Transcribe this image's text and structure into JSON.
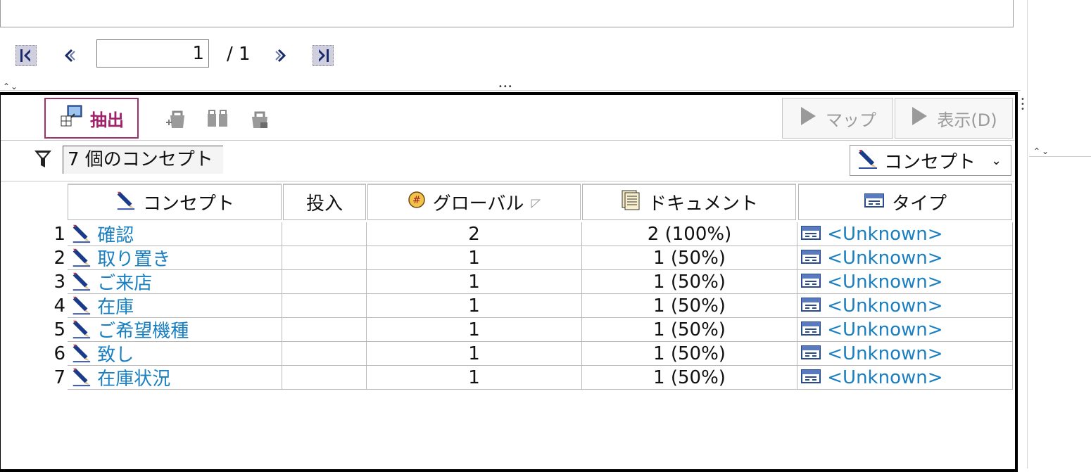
{
  "pager": {
    "current_page": "1",
    "total": "/ 1"
  },
  "toolbar": {
    "extract_label": "抽出",
    "map_label": "マップ",
    "show_label": "表示(D)"
  },
  "filter": {
    "summary": "7 個のコンセプト",
    "view_select": "コンセプト"
  },
  "table": {
    "headers": {
      "concept": "コンセプト",
      "input": "投入",
      "global": "グローバル",
      "document": "ドキュメント",
      "type": "タイプ"
    },
    "rows": [
      {
        "index": "1",
        "concept": "確認",
        "input": "",
        "global": "2",
        "document": "2 (100%)",
        "type": "<Unknown>"
      },
      {
        "index": "2",
        "concept": "取り置き",
        "input": "",
        "global": "1",
        "document": "1 (50%)",
        "type": "<Unknown>"
      },
      {
        "index": "3",
        "concept": "ご来店",
        "input": "",
        "global": "1",
        "document": "1 (50%)",
        "type": "<Unknown>"
      },
      {
        "index": "4",
        "concept": "在庫",
        "input": "",
        "global": "1",
        "document": "1 (50%)",
        "type": "<Unknown>"
      },
      {
        "index": "5",
        "concept": "ご希望機種",
        "input": "",
        "global": "1",
        "document": "1 (50%)",
        "type": "<Unknown>"
      },
      {
        "index": "6",
        "concept": "致し",
        "input": "",
        "global": "1",
        "document": "1 (50%)",
        "type": "<Unknown>"
      },
      {
        "index": "7",
        "concept": "在庫状況",
        "input": "",
        "global": "1",
        "document": "1 (50%)",
        "type": "<Unknown>"
      }
    ]
  },
  "colors": {
    "link": "#1a7fc0",
    "extract": "#a0206a",
    "disabled": "#9a9a9a"
  },
  "icons": [
    "first-page-icon",
    "prev-page-icon",
    "next-page-icon",
    "last-page-icon",
    "extract-icon",
    "pencil-icon",
    "filter-icon",
    "hash-icon",
    "document-icon",
    "type-icon",
    "play-icon",
    "chevron-down-icon"
  ]
}
